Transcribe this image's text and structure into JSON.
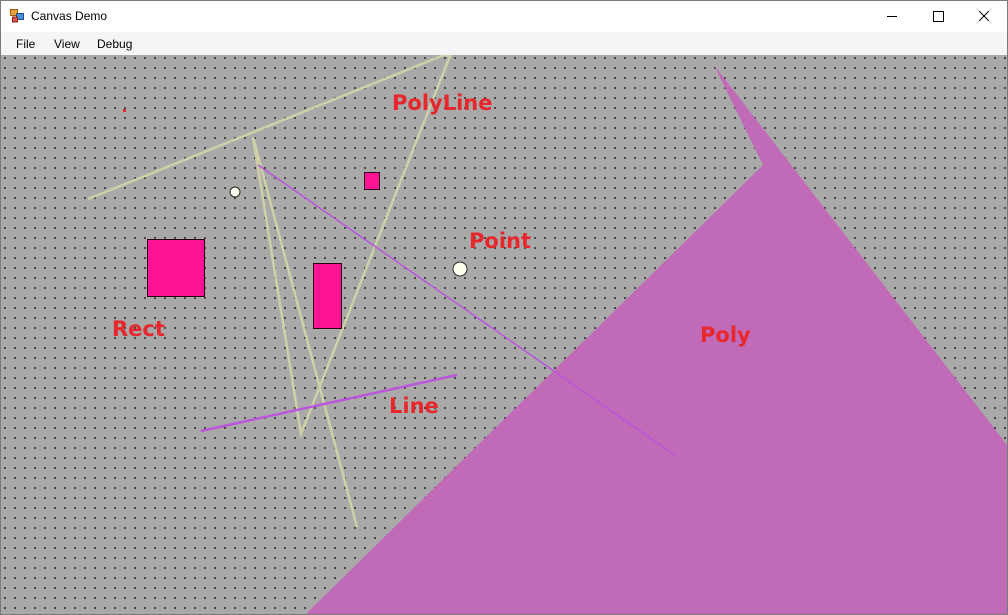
{
  "window": {
    "title": "Canvas Demo",
    "controls": {
      "minimize_icon": "minimize-icon",
      "maximize_icon": "maximize-icon",
      "close_icon": "close-icon"
    }
  },
  "menu": {
    "items": [
      "File",
      "View",
      "Debug"
    ]
  },
  "canvas": {
    "background": "#a9a9a9",
    "grid": "dotted",
    "labels": {
      "polyline": "PolyLine",
      "point": "Point",
      "rect": "Rect",
      "poly": "Poly",
      "line": "Line"
    },
    "colors": {
      "label_text": "#e8272d",
      "rect_fill": "#ff1493",
      "polygon_fill": "#c06ab8",
      "line_stroke": "#bb55dd",
      "polyline_stroke": "#cfd0a8",
      "point_fill": "#fffff0"
    }
  }
}
